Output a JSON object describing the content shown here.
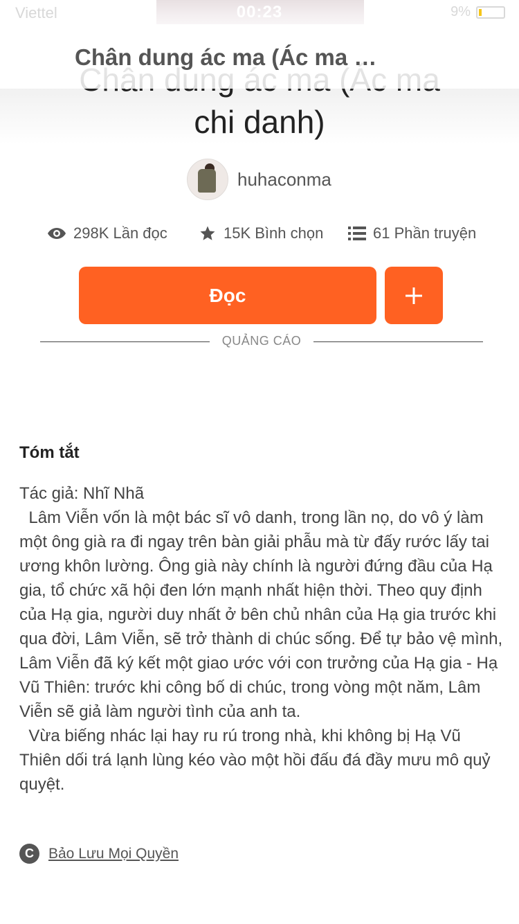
{
  "status_bar": {
    "carrier": "Viettel",
    "time": "00:23",
    "battery": "9%",
    "battery_level": 0.09
  },
  "nav": {
    "title": "Chân dung ác ma (Ác ma c..."
  },
  "story": {
    "title": "Chân dung ác ma (Ác ma chi danh)",
    "author": "huhaconma"
  },
  "stats": {
    "reads": "298K Lần đọc",
    "votes": "15K Bình chọn",
    "parts": "61 Phần truyện",
    "reads_icon": "eye-icon",
    "votes_icon": "star-icon",
    "parts_icon": "list-icon"
  },
  "actions": {
    "read_label": "Đọc",
    "add_icon": "plus-icon"
  },
  "ad": {
    "label": "QUẢNG CÁO"
  },
  "summary": {
    "heading": "Tóm tắt",
    "paragraphs": [
      "Tác giả: Nhĩ Nhã\n  Lâm Viễn vốn là một bác sĩ vô danh, trong lần nọ, do vô ý làm một ông già ra đi ngay trên bàn giải phẫu mà từ đấy rước lấy tai ương khôn lường. Ông già này chính là người đứng đầu của Hạ gia, tổ chức xã hội đen lớn mạnh nhất hiện thời. Theo quy định của Hạ gia, người duy nhất ở bên chủ nhân của Hạ gia trước khi qua đời, Lâm Viễn, sẽ trở thành di chúc sống. Để tự bảo vệ mình, Lâm Viễn đã ký kết một giao ước với con trưởng của Hạ gia - Hạ Vũ Thiên: trước khi công bố di chúc, trong vòng một năm, Lâm Viễn sẽ giả làm người tình của anh ta.\n  Vừa biếng nhác lại hay ru rú trong nhà, khi không bị Hạ Vũ Thiên dối trá lạnh lùng kéo vào một hồi đấu đá đầy mưu mô quỷ quyệt."
    ]
  },
  "rights": {
    "icon": "copyright-icon",
    "label": "Bảo Lưu Mọi Quyền"
  },
  "colors": {
    "accent": "#ff6122",
    "text_dark": "#222222",
    "text_muted": "#555555"
  }
}
